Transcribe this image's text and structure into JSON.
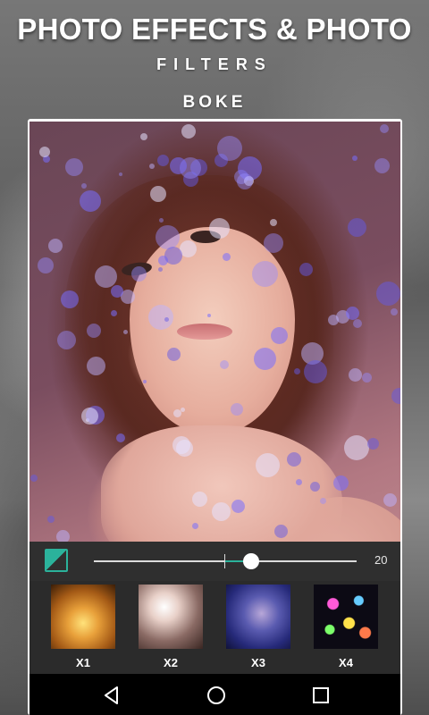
{
  "header": {
    "title": "PHOTO EFFECTS & PHOTO",
    "subtitle": "FILTERS",
    "section": "BOKE"
  },
  "editor": {
    "slider": {
      "value_label": "20",
      "fraction": 0.6
    },
    "accent_color": "#2bb29b"
  },
  "effects": [
    {
      "label": "X1"
    },
    {
      "label": "X2"
    },
    {
      "label": "X3"
    },
    {
      "label": "X4"
    }
  ],
  "nav": {
    "icons": [
      "back-icon",
      "home-icon",
      "recents-icon"
    ]
  }
}
